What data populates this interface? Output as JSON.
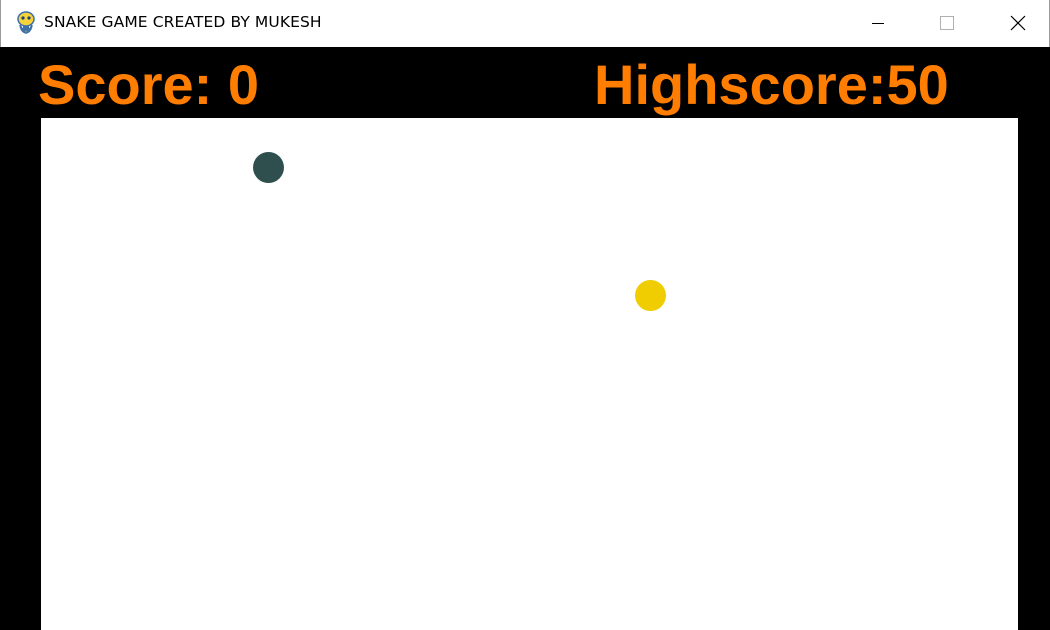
{
  "window": {
    "title": "SNAKE GAME CREATED BY MUKESH",
    "icon": "pygame-snake-icon",
    "controls": [
      "minimize-icon",
      "maximize-icon",
      "close-icon"
    ]
  },
  "hud": {
    "score_text": "Score: 0",
    "highscore_text": "Highscore:50",
    "score": 0,
    "highscore": 50
  },
  "colors": {
    "background": "#000000",
    "playfield": "#ffffff",
    "hud_text": "#ff7d00",
    "snake": "#2f4f4f",
    "food": "#f0cd00"
  }
}
